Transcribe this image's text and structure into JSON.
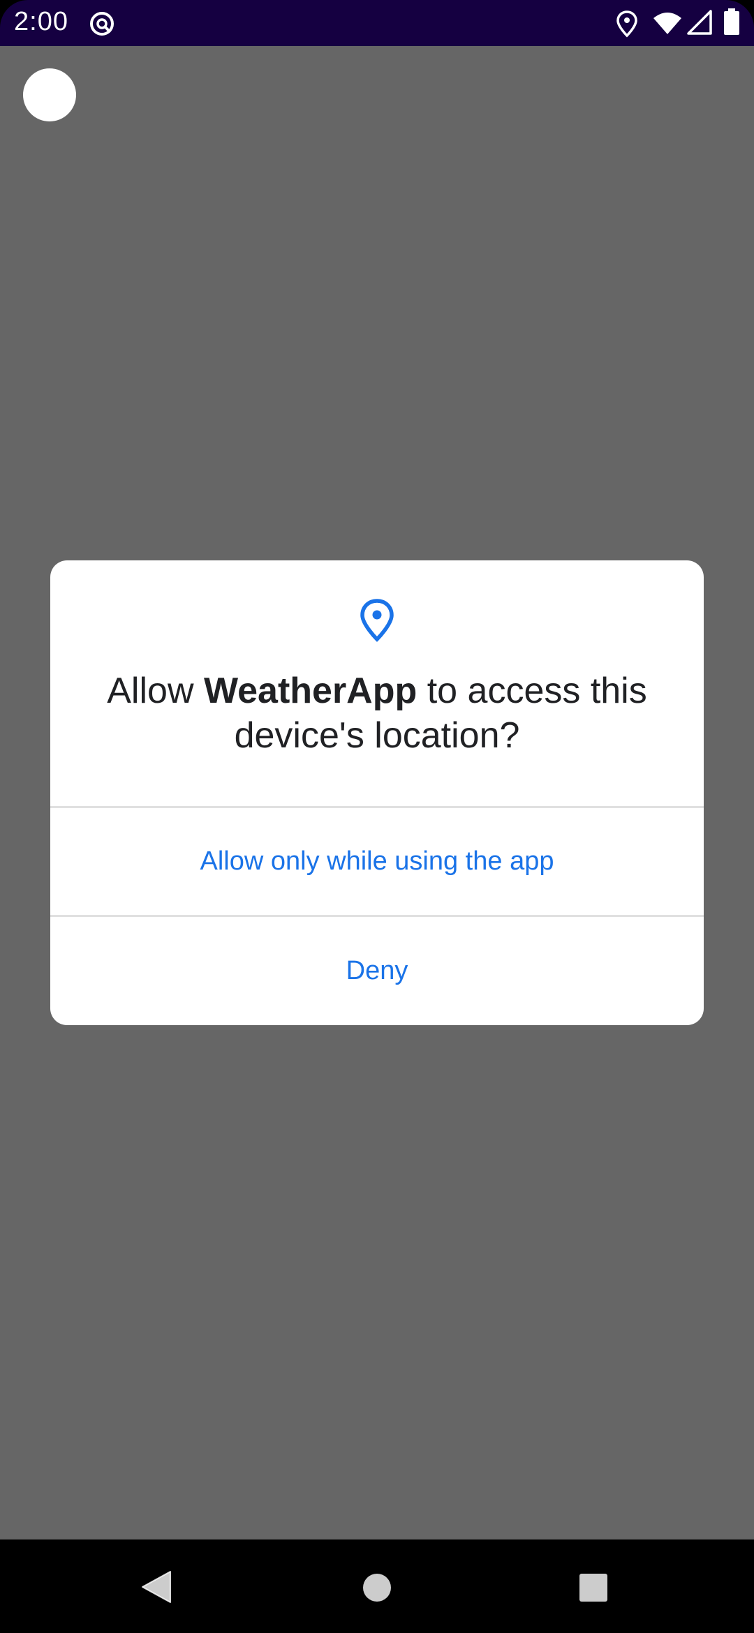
{
  "status_bar": {
    "time": "2:00",
    "icons": [
      "sync-icon",
      "location-icon",
      "wifi-icon",
      "signal-icon",
      "battery-icon"
    ],
    "background_color": "#150041"
  },
  "overlay_color": "#666666",
  "dialog": {
    "icon": "location-pin-icon",
    "title_prefix": "Allow ",
    "app_name": "WeatherApp",
    "title_suffix": " to access this device's location?",
    "allow_button": "Allow only while using the app",
    "deny_button": "Deny",
    "accent_color": "#1a73e8"
  },
  "nav_bar": {
    "buttons": [
      "back-icon",
      "home-icon",
      "recents-icon"
    ]
  }
}
